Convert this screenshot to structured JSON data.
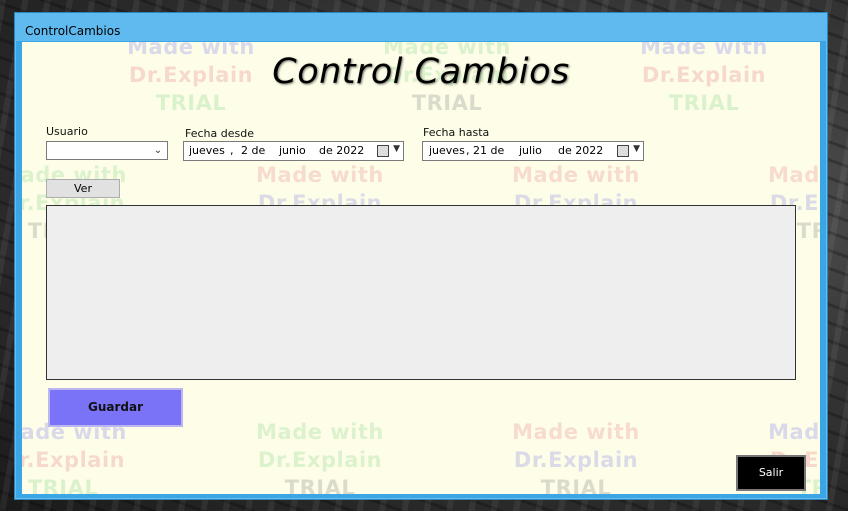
{
  "window": {
    "title": "ControlCambios"
  },
  "header": {
    "title": "Control Cambios"
  },
  "usuario": {
    "label": "Usuario",
    "value": ""
  },
  "fecha_desde": {
    "label": "Fecha desde",
    "weekday": "jueves",
    "sep": ",",
    "day": "2 de",
    "month": "junio",
    "year": "de 2022"
  },
  "fecha_hasta": {
    "label": "Fecha hasta",
    "weekday": "jueves",
    "sep": ", 21 de",
    "month": "julio",
    "year": "de 2022"
  },
  "buttons": {
    "ver": "Ver",
    "guardar": "Guardar",
    "salir": "Salir"
  },
  "watermark": {
    "line1": "Made with",
    "line2": "Dr.Explain",
    "line3": "TRIAL"
  },
  "colors": {
    "titlebar": "#5fbbef",
    "client_bg": "#fefee8",
    "guardar_bg": "#7b73f7",
    "salir_bg": "#000000"
  }
}
